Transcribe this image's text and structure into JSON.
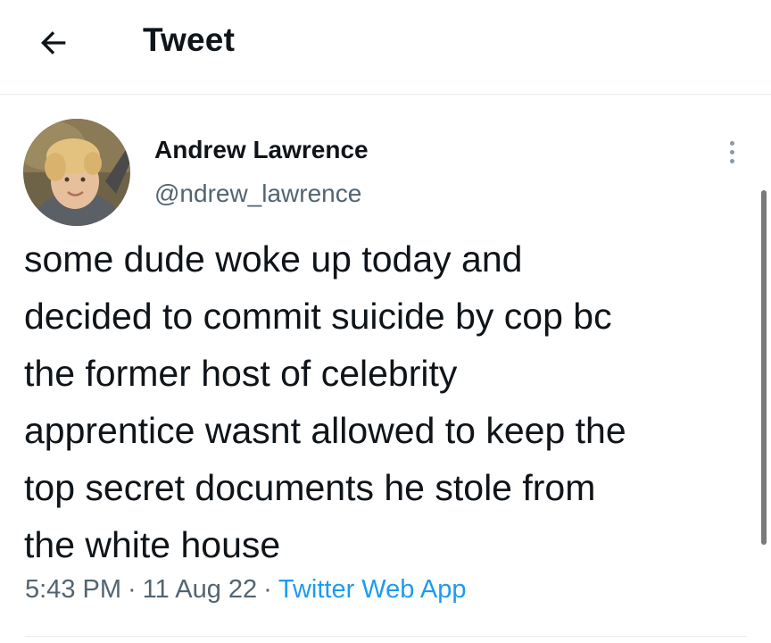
{
  "header": {
    "title": "Tweet",
    "back_icon": "arrow-left-icon"
  },
  "tweet": {
    "author": {
      "name": "Andrew Lawrence",
      "handle": "@ndrew_lawrence"
    },
    "more_icon": "more-vertical-icon",
    "text": "some dude woke up today and\ndecided to commit suicide by cop bc\nthe former host of celebrity\napprentice wasnt allowed to keep the\ntop secret documents he stole from\nthe white house",
    "time": "5:43 PM",
    "date": "11 Aug 22",
    "separator": "·",
    "source": "Twitter Web App"
  },
  "colors": {
    "text": "#0f1419",
    "secondary": "#536471",
    "link": "#1d9bf0",
    "divider": "#e6ecf0"
  }
}
